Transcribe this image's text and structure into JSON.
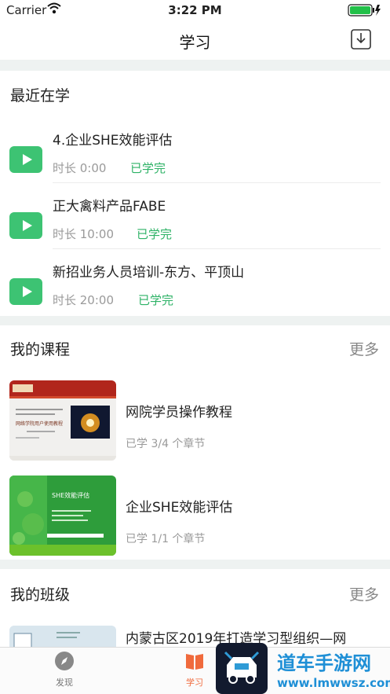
{
  "status_bar": {
    "carrier": "Carrier",
    "time": "3:22 PM"
  },
  "nav": {
    "title": "学习"
  },
  "recent": {
    "title": "最近在学",
    "items": [
      {
        "title": "4.企业SHE效能评估",
        "duration": "时长 0:00",
        "status": "已学完"
      },
      {
        "title": "正大禽料产品FABE",
        "duration": "时长 10:00",
        "status": "已学完"
      },
      {
        "title": "新招业务人员培训-东方、平顶山",
        "duration": "时长 20:00",
        "status": "已学完"
      }
    ]
  },
  "courses": {
    "title": "我的课程",
    "more": "更多",
    "items": [
      {
        "title": "网院学员操作教程",
        "progress": "已学 3/4 个章节",
        "thumb_text": "网络学院用户使用教程"
      },
      {
        "title": "企业SHE效能评估",
        "progress": "已学 1/1 个章节",
        "thumb_text": "SHE效能评估"
      }
    ]
  },
  "classes": {
    "title": "我的班级",
    "more": "更多",
    "items": [
      {
        "title": "内蒙古区2019年打造学习型组织—网"
      }
    ]
  },
  "tabs": [
    {
      "label": "发现",
      "icon": "compass-icon",
      "active": false
    },
    {
      "label": "学习",
      "icon": "book-icon",
      "active": true
    }
  ],
  "watermark": {
    "text": "道车手游网",
    "url": "www.lmwwsz.com"
  },
  "colors": {
    "accent_green": "#3dc373",
    "status_green": "#2db266",
    "tab_active": "#f06a3c",
    "gap": "#eef2f1"
  }
}
